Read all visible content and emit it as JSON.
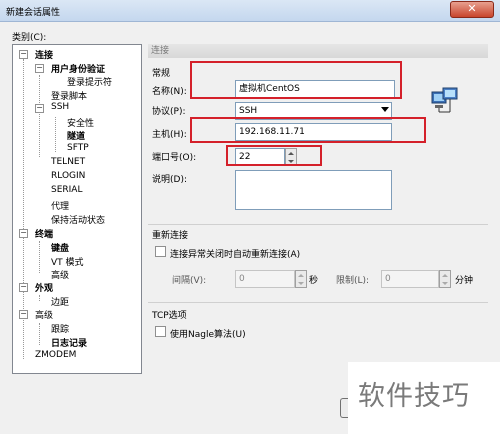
{
  "window": {
    "title": "新建会话属性",
    "close_glyph": "✕"
  },
  "category": {
    "label": "类别(C):",
    "tree": [
      {
        "label": "连接",
        "bold": true
      },
      {
        "label": "用户身份验证",
        "bold": true
      },
      {
        "label": "登录提示符",
        "bold": false
      },
      {
        "label": "登录脚本",
        "bold": false
      },
      {
        "label": "SSH",
        "bold": false
      },
      {
        "label": "安全性",
        "bold": false
      },
      {
        "label": "隧道",
        "bold": true
      },
      {
        "label": "SFTP",
        "bold": false
      },
      {
        "label": "TELNET",
        "bold": false
      },
      {
        "label": "RLOGIN",
        "bold": false
      },
      {
        "label": "SERIAL",
        "bold": false
      },
      {
        "label": "代理",
        "bold": false
      },
      {
        "label": "保持活动状态",
        "bold": false
      },
      {
        "label": "终端",
        "bold": true
      },
      {
        "label": "键盘",
        "bold": true
      },
      {
        "label": "VT 模式",
        "bold": false
      },
      {
        "label": "高级",
        "bold": false
      },
      {
        "label": "外观",
        "bold": true
      },
      {
        "label": "边距",
        "bold": false
      },
      {
        "label": "高级",
        "bold": false
      },
      {
        "label": "跟踪",
        "bold": false
      },
      {
        "label": "日志记录",
        "bold": true
      },
      {
        "label": "ZMODEM",
        "bold": false
      }
    ]
  },
  "panel": {
    "header": "连接",
    "general": {
      "title": "常规",
      "name_label": "名称(N):",
      "name_value": "虚拟机CentOS",
      "protocol_label": "协议(P):",
      "protocol_value": "SSH",
      "host_label": "主机(H):",
      "host_value": "192.168.11.71",
      "port_label": "端口号(O):",
      "port_value": "22",
      "desc_label": "说明(D):",
      "desc_value": ""
    },
    "reconnect": {
      "title": "重新连接",
      "auto_reconnect_label": "连接异常关闭时自动重新连接(A)",
      "interval_label": "间隔(V):",
      "interval_value": "0",
      "sec_unit": "秒",
      "limit_label": "限制(L):",
      "limit_value": "0",
      "min_unit": "分钟"
    },
    "tcp": {
      "title": "TCP选项",
      "nagle_label": "使用Nagle算法(U)"
    }
  },
  "watermark": {
    "text": "软件技巧"
  },
  "colors": {
    "highlight_box": "#d4202a",
    "header_text": "#7a7a7a"
  }
}
